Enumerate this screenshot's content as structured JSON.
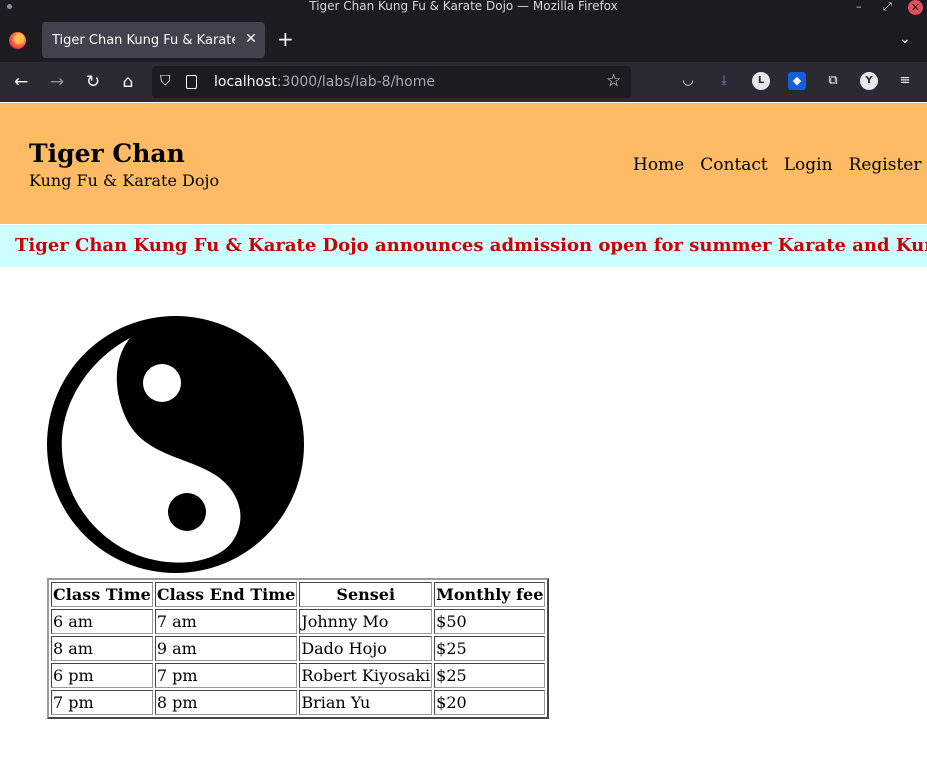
{
  "window": {
    "title": "Tiger Chan Kung Fu & Karate Dojo — Mozilla Firefox"
  },
  "browser": {
    "tab_title": "Tiger Chan Kung Fu & Karate Dojo",
    "url_host": "localhost",
    "url_path": ":3000/labs/lab-8/home"
  },
  "header": {
    "brand_name": "Tiger Chan",
    "brand_tagline": "Kung Fu & Karate Dojo",
    "nav": [
      "Home",
      "Contact",
      "Login",
      "Register"
    ]
  },
  "announcement": "Tiger Chan Kung Fu & Karate Dojo announces admission open for summer Karate and Kung Fu Classes",
  "schedule": {
    "headers": [
      "Class Time",
      "Class End Time",
      "Sensei",
      "Monthly fee"
    ],
    "rows": [
      [
        "6 am",
        "7 am",
        "Johnny Mo",
        "$50"
      ],
      [
        "8 am",
        "9 am",
        "Dado Hojo",
        "$25"
      ],
      [
        "6 pm",
        "7 pm",
        "Robert Kiyosaki",
        "$25"
      ],
      [
        "7 pm",
        "8 pm",
        "Brian Yu",
        "$20"
      ]
    ]
  },
  "colors": {
    "header_bg": "#ffba66",
    "marquee_bg": "#ccffff",
    "marquee_text": "#cc0000"
  }
}
